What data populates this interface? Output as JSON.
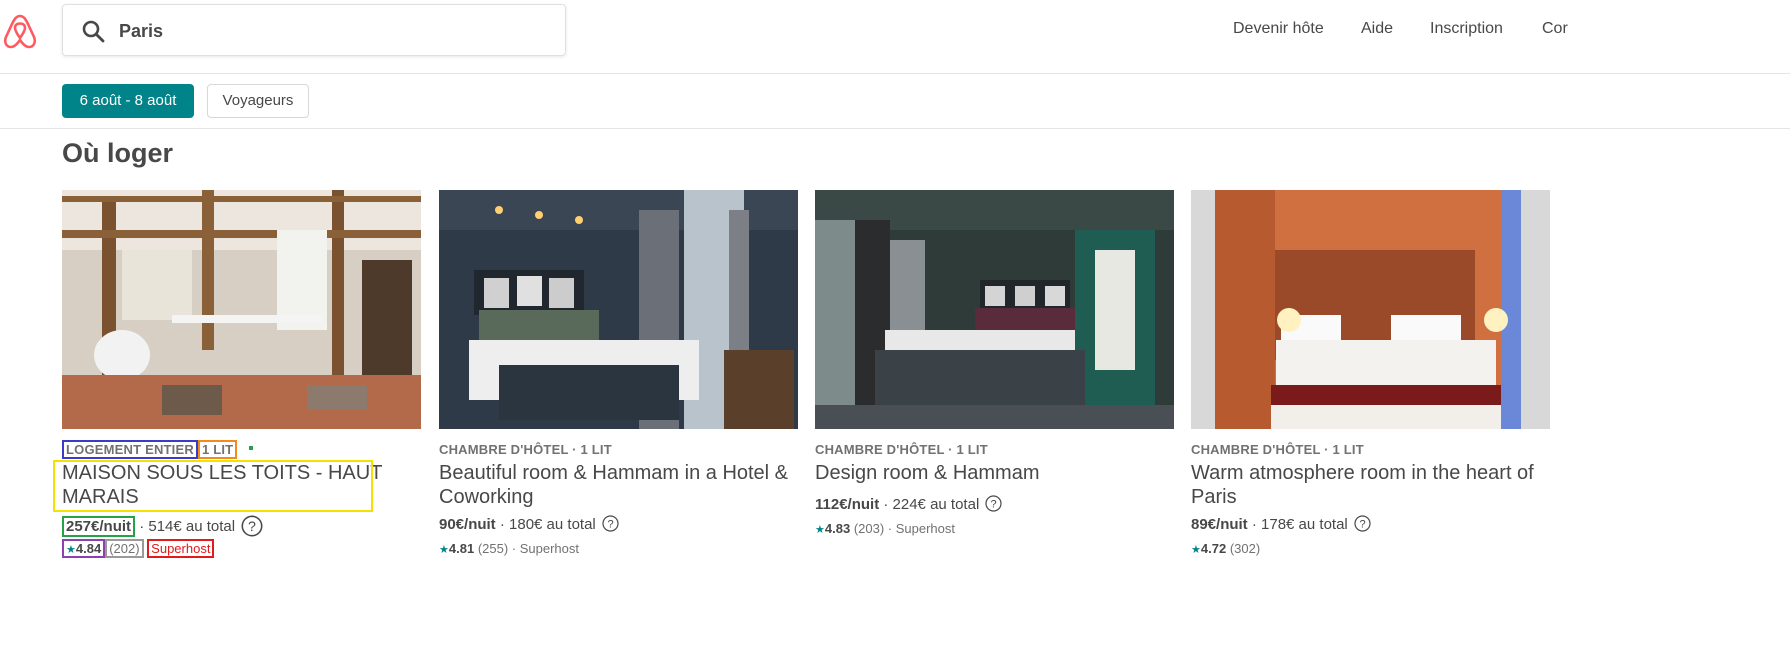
{
  "search": {
    "value": "Paris",
    "icon": "search-icon"
  },
  "nav": {
    "host": "Devenir hôte",
    "help": "Aide",
    "signup": "Inscription",
    "login": "Cor"
  },
  "filters": {
    "dates": "6 août - 8 août",
    "guests": "Voyageurs"
  },
  "section_title": "Où loger",
  "colors": {
    "accent": "#008489",
    "brand": "#FF5A5F",
    "text": "#484848"
  },
  "listings": [
    {
      "type": "LOGEMENT ENTIER",
      "beds": "1 LIT",
      "title": "MAISON SOUS LES TOITS - HAUT MARAIS",
      "price": "257€/nuit",
      "total": " · 514€ au total",
      "rating": "4.84",
      "reviews": "(202)",
      "badge": "Superhost"
    },
    {
      "kicker": "CHAMBRE D'HÔTEL · 1 LIT",
      "title": "Beautiful room & Hammam in a Hotel & Coworking",
      "price": "90€/nuit",
      "total": " · 180€ au total",
      "rating": "4.81",
      "reviews": "(255)",
      "badge": " · Superhost"
    },
    {
      "kicker": "CHAMBRE D'HÔTEL · 1 LIT",
      "title": "Design room & Hammam",
      "price": "112€/nuit",
      "total": " · 224€ au total",
      "rating": "4.83",
      "reviews": "(203)",
      "badge": " · Superhost"
    },
    {
      "kicker": "CHAMBRE D'HÔTEL · 1 LIT",
      "title": "Warm atmosphere room in the heart of Paris",
      "price": "89€/nuit",
      "total": " · 178€ au total",
      "rating": "4.72",
      "reviews": "(302)",
      "badge": ""
    }
  ]
}
